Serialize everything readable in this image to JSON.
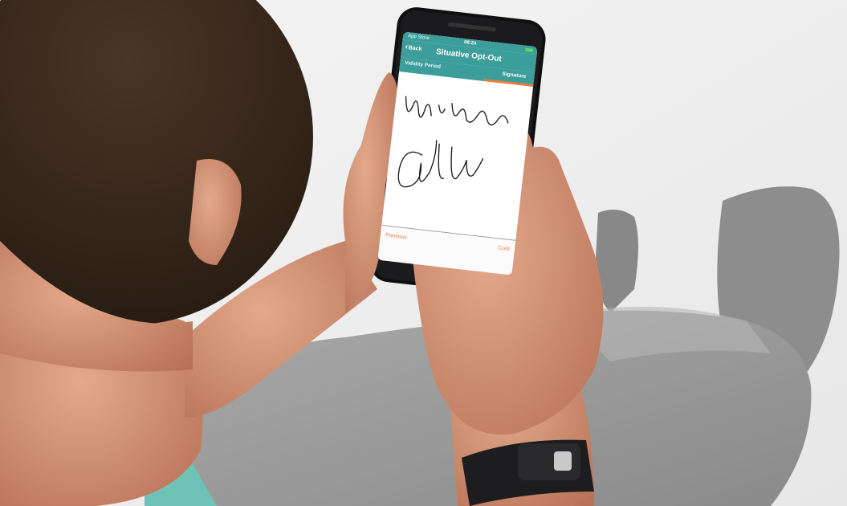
{
  "phone_app": {
    "status_bar": {
      "carrier": "App Store",
      "time": "08:24"
    },
    "nav": {
      "back_label": "Back",
      "title": "Situative Opt-Out"
    },
    "tabs": [
      {
        "label": "Validity Period"
      },
      {
        "label": "Signature"
      }
    ],
    "buttons": {
      "previous": "Previous",
      "continue": "Cont"
    },
    "colors": {
      "header": "#3b9e9a",
      "accent": "#f07a3b"
    }
  },
  "icons": {
    "back": "chevron-left-icon",
    "battery": "battery-icon"
  }
}
